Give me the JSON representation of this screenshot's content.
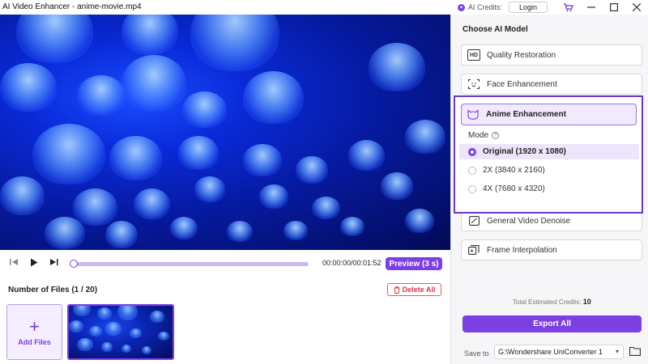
{
  "window": {
    "title": "AI Video Enhancer - anime-movie.mp4",
    "credits_label": "AI Credits:",
    "login_label": "Login",
    "cart_icon": "cart-icon",
    "minimize_icon": "minimize-icon",
    "maximize_icon": "maximize-icon",
    "close_icon": "close-icon"
  },
  "player": {
    "time": "00:00:00/00:01:52",
    "preview_label": "Preview (3 s)",
    "progress": 0
  },
  "files": {
    "count_label": "Number of Files (1 / 20)",
    "delete_label": "Delete All",
    "add_label": "Add Files"
  },
  "panel": {
    "title": "Choose AI Model",
    "models": [
      {
        "label": "Quality Restoration",
        "icon": "hd-icon"
      },
      {
        "label": "Face Enhancement",
        "icon": "face-scan-icon"
      },
      {
        "label": "Anime Enhancement",
        "icon": "anime-icon"
      },
      {
        "label": "General Video Denoise",
        "icon": "denoise-icon"
      },
      {
        "label": "Frame Interpolation",
        "icon": "frame-interpolation-icon"
      }
    ],
    "mode_label": "Mode",
    "modes": [
      {
        "label": "Original (1920 x 1080)",
        "selected": true
      },
      {
        "label": "2X (3840 x 2160)",
        "selected": false
      },
      {
        "label": "4X (7680 x 4320)",
        "selected": false
      }
    ],
    "estimated_label": "Total Estimated Credits:",
    "estimated_value": "10",
    "export_label": "Export All",
    "save_to_label": "Save to",
    "save_path": "G:\\Wondershare UniConverter 1"
  },
  "colors": {
    "accent": "#7b3fe4",
    "highlight_border": "#6a38c7",
    "delete": "#d8394c"
  }
}
